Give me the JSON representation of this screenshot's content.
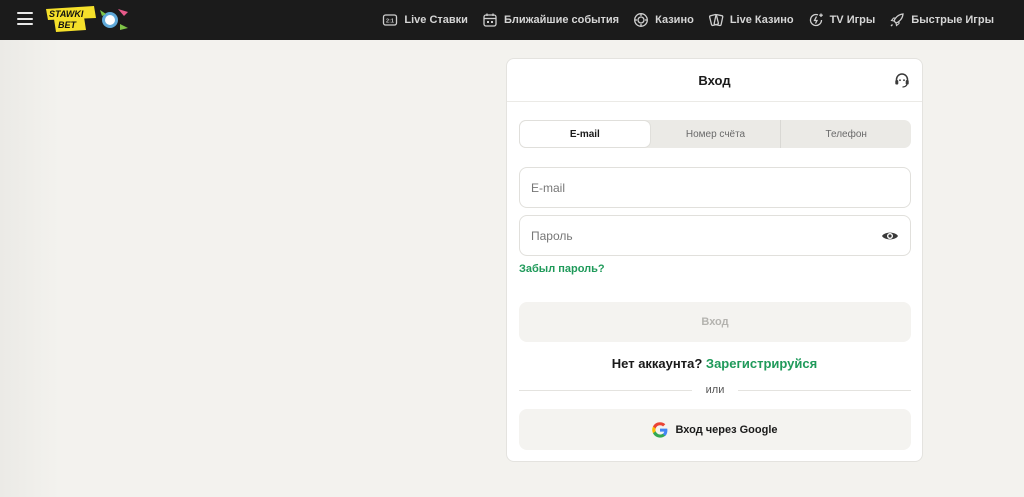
{
  "brand": {
    "logo_text_top": "STAWKI",
    "logo_text_bottom": "BET",
    "accent": "#f5e02a"
  },
  "nav": {
    "items": [
      {
        "label": "Live Ставки",
        "icon": "live-score-icon"
      },
      {
        "label": "Ближайшие события",
        "icon": "calendar-icon"
      },
      {
        "label": "Казино",
        "icon": "casino-chip-icon"
      },
      {
        "label": "Live Казино",
        "icon": "cards-icon"
      },
      {
        "label": "TV Игры",
        "icon": "tv-games-icon"
      },
      {
        "label": "Быстрые Игры",
        "icon": "rocket-icon"
      }
    ]
  },
  "login": {
    "title": "Вход",
    "tabs": [
      {
        "label": "E-mail",
        "active": true
      },
      {
        "label": "Номер счёта",
        "active": false
      },
      {
        "label": "Телефон",
        "active": false
      }
    ],
    "email_placeholder": "E-mail",
    "email_value": "",
    "password_placeholder": "Пароль",
    "password_value": "",
    "forgot_label": "Забыл пароль?",
    "submit_label": "Вход",
    "no_account_text": "Нет аккаунта?",
    "register_label": "Зарегистрируйся",
    "or_label": "или",
    "google_label": "Вход через Google"
  },
  "colors": {
    "link_green": "#1f9a5a",
    "topbar": "#1b1b1b",
    "page_bg": "#f3f2ee"
  }
}
